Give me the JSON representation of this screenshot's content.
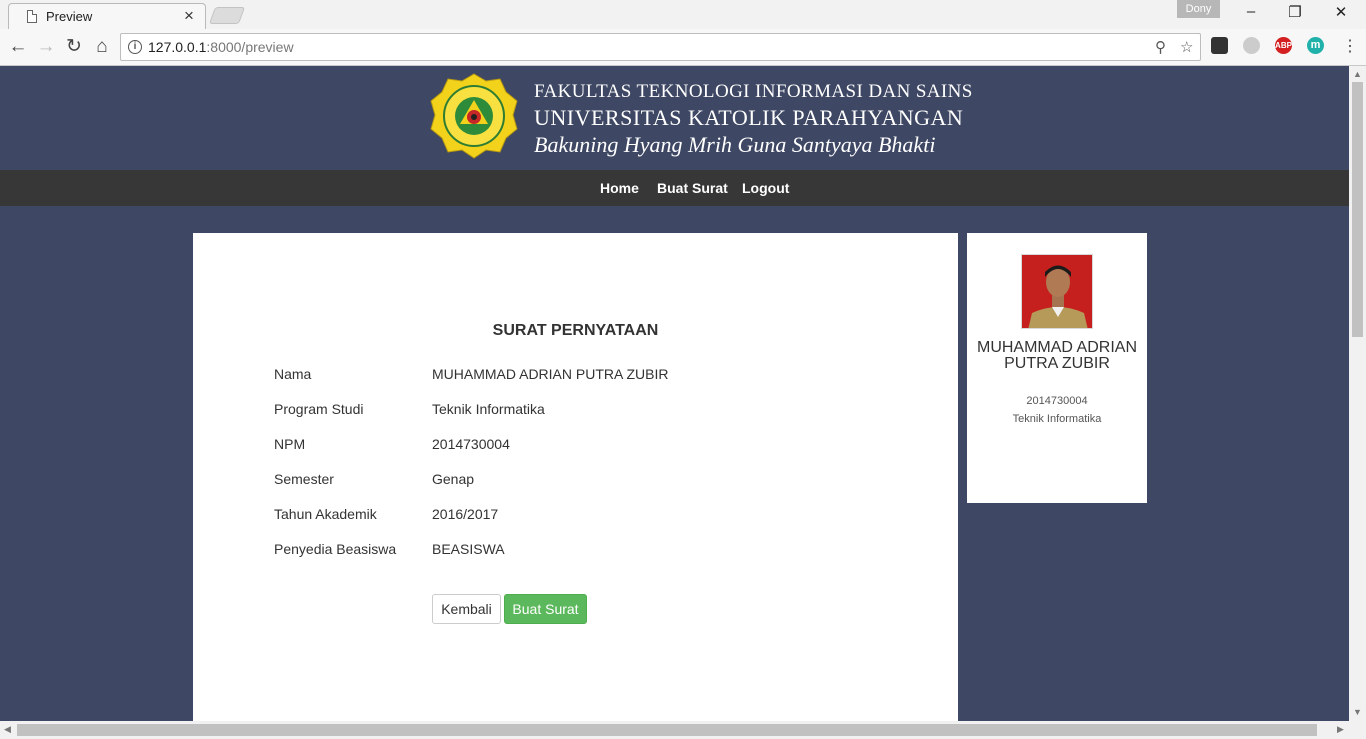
{
  "browser": {
    "tab_title": "Preview",
    "profile_name": "Dony",
    "url_host": "127.0.0.1",
    "url_path": ":8000/preview",
    "extensions": [
      {
        "name": "trello-icon",
        "label": "",
        "color": "#333333"
      },
      {
        "name": "search-ext-icon",
        "label": "",
        "color": "#bbbbbb"
      },
      {
        "name": "adblock-plus-icon",
        "label": "ABP",
        "color": "#d42020"
      },
      {
        "name": "m-ext-icon",
        "label": "m",
        "color": "#20b2aa"
      }
    ]
  },
  "header": {
    "faculty": "FAKULTAS TEKNOLOGI INFORMASI DAN SAINS",
    "university": "UNIVERSITAS KATOLIK PARAHYANGAN",
    "motto": "Bakuning Hyang Mrih Guna Santyaya Bhakti",
    "logo_text_top": "UNIVERSITAS KATOLIK",
    "logo_text_bottom": "PARAHYANGAN"
  },
  "nav": {
    "home": "Home",
    "buat_surat": "Buat Surat",
    "logout": "Logout"
  },
  "letter": {
    "title": "SURAT PERNYATAAN",
    "fields": [
      {
        "label": "Nama",
        "value": "MUHAMMAD ADRIAN PUTRA ZUBIR"
      },
      {
        "label": "Program Studi",
        "value": "Teknik Informatika"
      },
      {
        "label": "NPM",
        "value": "2014730004"
      },
      {
        "label": "Semester",
        "value": "Genap"
      },
      {
        "label": "Tahun Akademik",
        "value": "2016/2017"
      },
      {
        "label": "Penyedia Beasiswa",
        "value": "BEASISWA"
      }
    ],
    "back_button": "Kembali",
    "submit_button": "Buat Surat"
  },
  "profile": {
    "name": "MUHAMMAD ADRIAN PUTRA ZUBIR",
    "npm": "2014730004",
    "prodi": "Teknik Informatika"
  },
  "colors": {
    "page_bg": "#3e4763",
    "navbar_bg": "#373737",
    "success": "#5cb85c"
  }
}
